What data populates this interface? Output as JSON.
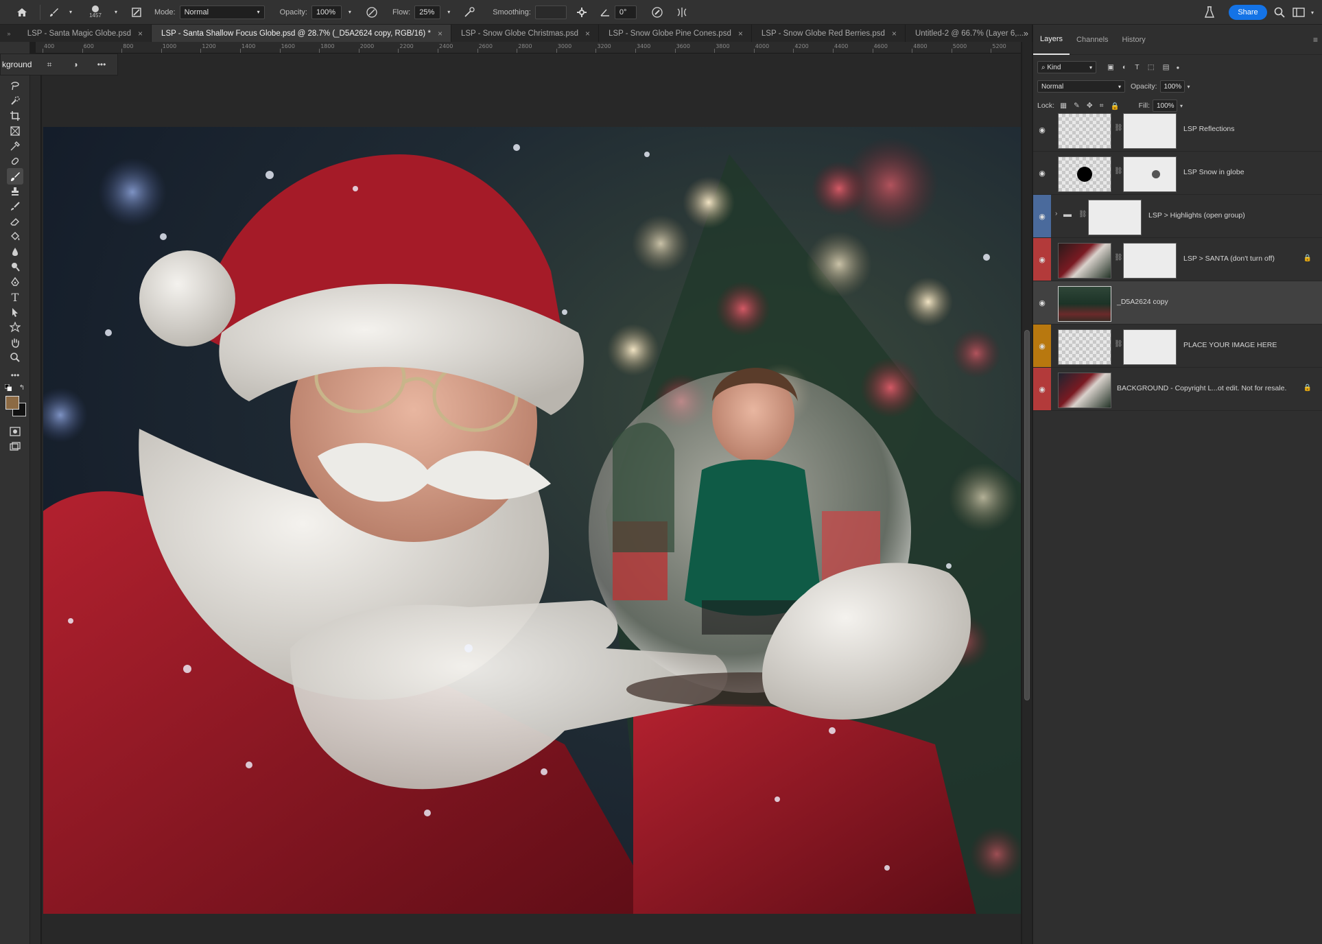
{
  "options_bar": {
    "brush_size": "1457",
    "mode_label": "Mode:",
    "mode_value": "Normal",
    "opacity_label": "Opacity:",
    "opacity_value": "100%",
    "flow_label": "Flow:",
    "flow_value": "25%",
    "smoothing_label": "Smoothing:",
    "angle_value": "0°",
    "share_label": "Share"
  },
  "tabs": [
    {
      "label": "LSP - Santa Magic Globe.psd"
    },
    {
      "label": "LSP - Santa Shallow Focus Globe.psd @ 28.7% (_D5A2624 copy, RGB/16) *"
    },
    {
      "label": "LSP - Snow Globe Christmas.psd"
    },
    {
      "label": "LSP - Snow Globe Pine Cones.psd"
    },
    {
      "label": "LSP - Snow Globe Red Berries.psd"
    },
    {
      "label": "Untitled-2 @ 66.7% (Layer 6,..."
    }
  ],
  "ruler_ticks": [
    "400",
    "600",
    "800",
    "1000",
    "1200",
    "1400",
    "1600",
    "1800",
    "2000",
    "2200",
    "2400",
    "2600",
    "2800",
    "3000",
    "3200",
    "3400",
    "3600",
    "3800",
    "4000",
    "4200",
    "4400",
    "4600",
    "4800",
    "5000",
    "5200"
  ],
  "context_bar": {
    "layer_label": "kground"
  },
  "panel": {
    "tabs": [
      "Layers",
      "Channels",
      "History"
    ],
    "kind_label": "Kind",
    "blend_mode": "Normal",
    "opacity_label": "Opacity:",
    "opacity_value": "100%",
    "lock_label": "Lock:",
    "fill_label": "Fill:",
    "fill_value": "100%"
  },
  "layers": [
    {
      "name": "LSP Reflections",
      "color": "none"
    },
    {
      "name": "LSP Snow in globe",
      "color": "none"
    },
    {
      "name": "LSP > Highlights (open group)",
      "color": "#4a6a9c"
    },
    {
      "name": "LSP > SANTA (don't turn off)",
      "color": "#b33a3a"
    },
    {
      "name": "_D5A2624 copy",
      "color": "none"
    },
    {
      "name": "PLACE YOUR IMAGE HERE",
      "color": "#b8780f"
    },
    {
      "name": "BACKGROUND - Copyright L...ot edit. Not for resale.",
      "color": "#b33a3a"
    }
  ],
  "colors": {
    "accent": "#1473e6",
    "panel_bg": "#2f2f2f",
    "canvas_bg": "#282828"
  }
}
